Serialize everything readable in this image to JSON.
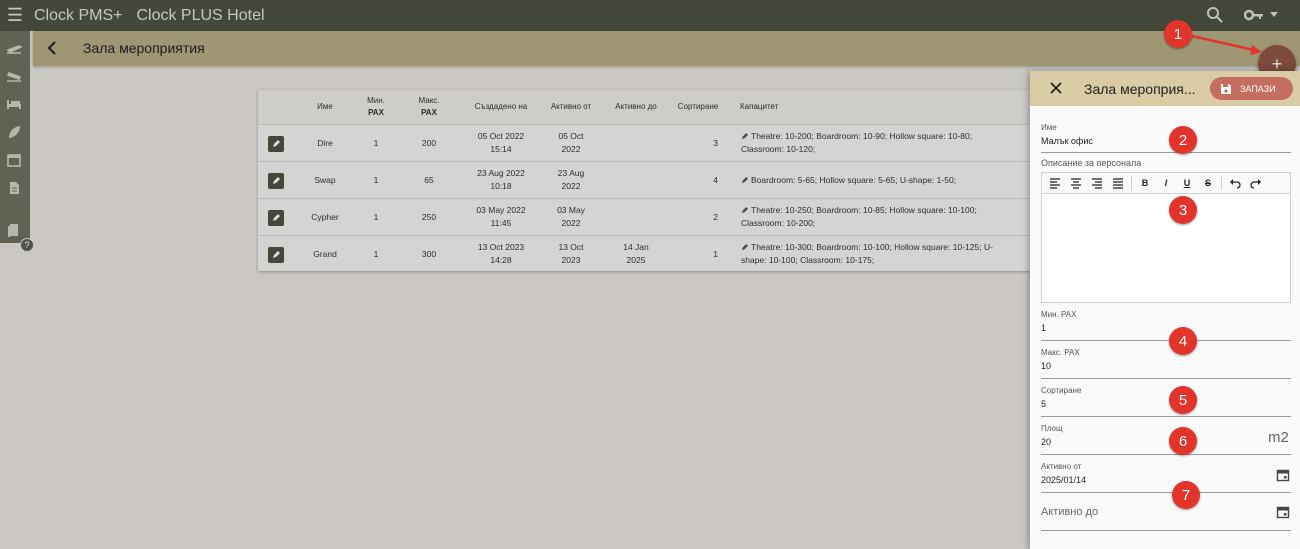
{
  "topbar": {
    "app_name": "Clock PMS+",
    "hotel_name": "Clock PLUS Hotel",
    "menu_icon": "menu-icon",
    "search_icon": "search-icon",
    "key_icon": "key-icon"
  },
  "page": {
    "title": "Зала мероприятия"
  },
  "table": {
    "headers": {
      "name": "Име",
      "min_pax_1": "Мин.",
      "min_pax_2": "PAX",
      "max_pax_1": "Макс.",
      "max_pax_2": "PAX",
      "created": "Създадено на",
      "active_from": "Активно от",
      "active_to": "Активно до",
      "sorting": "Сортиране",
      "capacity": "Капацитет"
    },
    "rows": [
      {
        "name": "Dire",
        "min": "1",
        "max": "200",
        "created_1": "05 Oct 2022",
        "created_2": "15:14",
        "from_1": "05 Oct",
        "from_2": "2022",
        "to_1": "",
        "to_2": "",
        "sort": "3",
        "cap_1": "Theatre: 10-200; Boardroom: 10-90; Hollow square: 10-80;",
        "cap_2": "Classroom: 10-120;"
      },
      {
        "name": "Swap",
        "min": "1",
        "max": "65",
        "created_1": "23 Aug 2022",
        "created_2": "10:18",
        "from_1": "23 Aug",
        "from_2": "2022",
        "to_1": "",
        "to_2": "",
        "sort": "4",
        "cap_1": "Boardroom: 5-65; Hollow square: 5-65; U-shape: 1-50;",
        "cap_2": ""
      },
      {
        "name": "Cypher",
        "min": "1",
        "max": "250",
        "created_1": "03 May 2022",
        "created_2": "11:45",
        "from_1": "03 May",
        "from_2": "2022",
        "to_1": "",
        "to_2": "",
        "sort": "2",
        "cap_1": "Theatre: 10-250; Boardroom: 10-85; Hollow square: 10-100;",
        "cap_2": "Classroom: 10-200;"
      },
      {
        "name": "Grand",
        "min": "1",
        "max": "300",
        "created_1": "13 Oct 2023",
        "created_2": "14:28",
        "from_1": "13 Oct",
        "from_2": "2023",
        "to_1": "14 Jan",
        "to_2": "2025",
        "sort": "1",
        "cap_1": "Theatre: 10-300; Boardroom: 10-100; Hollow square: 10-125; U-",
        "cap_2": "shape: 10-100; Classroom: 10-175;"
      }
    ]
  },
  "panel": {
    "title": "Зала мероприя...",
    "save_label": "ЗАПАЗИ",
    "name_label": "Име",
    "name_value": "Малък офис",
    "desc_label": "Описание за персонала",
    "min_label": "Мин. PAX",
    "min_value": "1",
    "max_label": "Макс. PAX",
    "max_value": "10",
    "sort_label": "Сортиране",
    "sort_value": "5",
    "area_label": "Площ",
    "area_value": "20",
    "area_unit": "m2",
    "from_label": "Активно от",
    "from_value": "2025/01/14",
    "to_placeholder": "Активно до"
  },
  "toolbar": {
    "bold": "B",
    "italic": "I",
    "underline": "U",
    "strike": "S"
  },
  "fab": {
    "label": "+"
  },
  "markers": [
    "1",
    "2",
    "3",
    "4",
    "5",
    "6",
    "7"
  ],
  "colors": {
    "topbar": "#4d5242",
    "pagebar": "#b6ab83",
    "panel_header": "#d9cca5",
    "save_button": "#c56e5f",
    "fab": "#7c4b3d",
    "marker": "#e2342a"
  }
}
